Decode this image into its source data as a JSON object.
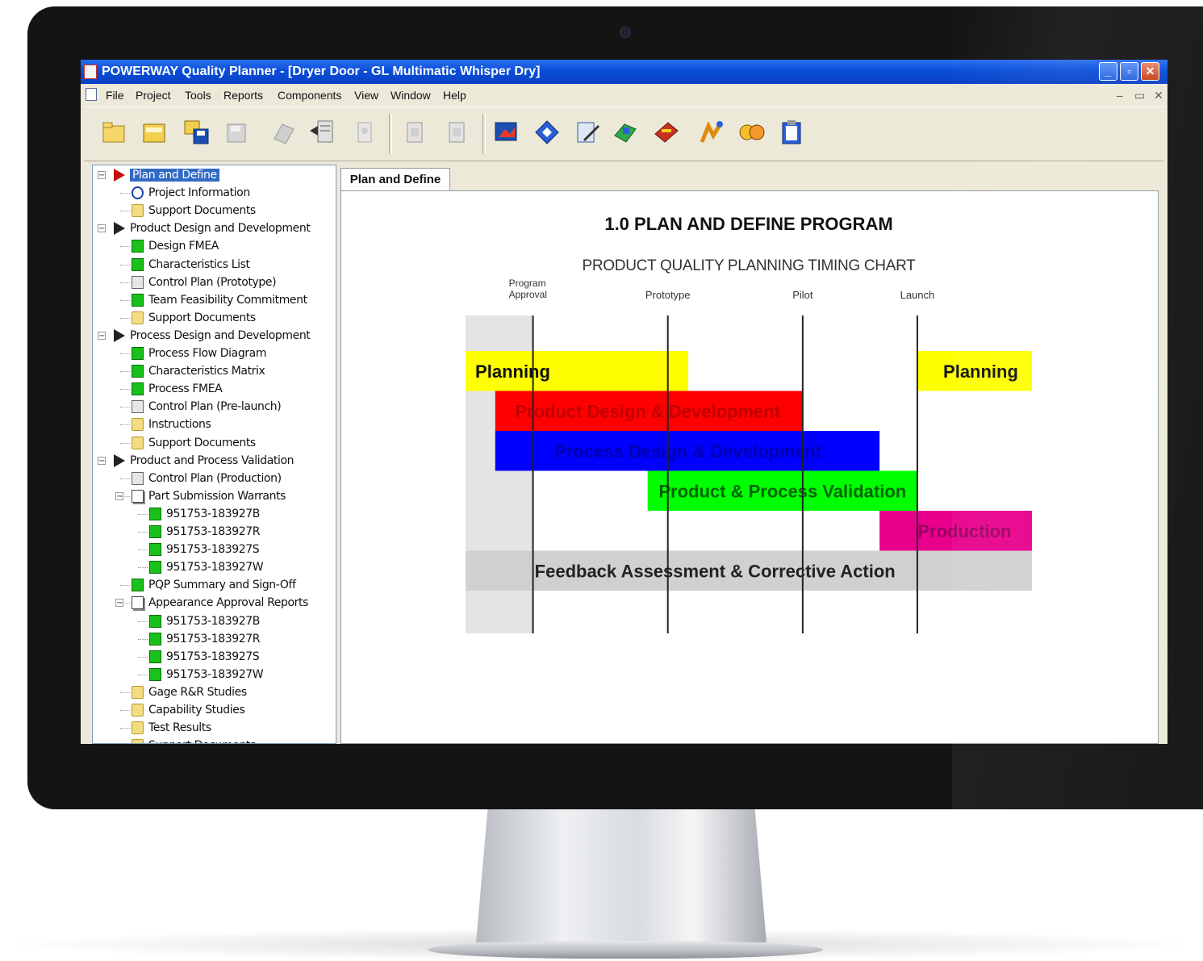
{
  "window": {
    "title": "POWERWAY Quality Planner - [Dryer Door - GL Multimatic Whisper Dry]"
  },
  "menu": [
    "File",
    "Project",
    "Tools",
    "Reports",
    "Components",
    "View",
    "Window",
    "Help"
  ],
  "toolbar_icons": [
    "new-icon",
    "open-icon",
    "copy-icon",
    "save-icon",
    "disabled-icon",
    "import-icon",
    "disabled-icon",
    "document-icon",
    "document-icon",
    "report-icon",
    "process-icon",
    "edit-icon",
    "design-icon",
    "tools-icon",
    "check-icon",
    "hands-icon",
    "clipboard-icon"
  ],
  "tree": [
    {
      "label": "Plan and Define",
      "icon": "red-arrow-icon",
      "selected": true
    },
    {
      "label": "Project Information",
      "icon": "info-icon"
    },
    {
      "label": "Support Documents",
      "icon": "folder-icon"
    },
    {
      "label": "Product Design and Development",
      "icon": "arrow-icon"
    },
    {
      "label": "Design FMEA",
      "icon": "green-doc-icon"
    },
    {
      "label": "Characteristics List",
      "icon": "green-doc-icon"
    },
    {
      "label": "Control Plan (Prototype)",
      "icon": "doc-icon"
    },
    {
      "label": "Team Feasibility Commitment",
      "icon": "green-doc-icon"
    },
    {
      "label": "Support Documents",
      "icon": "folder-icon"
    },
    {
      "label": "Process Design and Development",
      "icon": "arrow-icon"
    },
    {
      "label": "Process Flow Diagram",
      "icon": "green-doc-icon"
    },
    {
      "label": "Characteristics Matrix",
      "icon": "green-doc-icon"
    },
    {
      "label": "Process FMEA",
      "icon": "green-doc-icon"
    },
    {
      "label": "Control Plan (Pre-launch)",
      "icon": "doc-icon"
    },
    {
      "label": "Instructions",
      "icon": "folder-icon"
    },
    {
      "label": "Support Documents",
      "icon": "folder-icon"
    },
    {
      "label": "Product and Process Validation",
      "icon": "arrow-icon"
    },
    {
      "label": "Control Plan (Production)",
      "icon": "doc-icon"
    },
    {
      "label": "Part Submission Warrants",
      "icon": "multi-doc-icon"
    },
    {
      "label": "951753-183927B",
      "icon": "green-doc-icon"
    },
    {
      "label": "951753-183927R",
      "icon": "green-doc-icon"
    },
    {
      "label": "951753-183927S",
      "icon": "green-doc-icon"
    },
    {
      "label": "951753-183927W",
      "icon": "green-doc-icon"
    },
    {
      "label": "PQP Summary and Sign-Off",
      "icon": "green-doc-icon"
    },
    {
      "label": "Appearance Approval Reports",
      "icon": "multi-doc-icon"
    },
    {
      "label": "951753-183927B",
      "icon": "green-doc-icon"
    },
    {
      "label": "951753-183927R",
      "icon": "green-doc-icon"
    },
    {
      "label": "951753-183927S",
      "icon": "green-doc-icon"
    },
    {
      "label": "951753-183927W",
      "icon": "green-doc-icon"
    },
    {
      "label": "Gage R&R Studies",
      "icon": "folder-icon"
    },
    {
      "label": "Capability Studies",
      "icon": "folder-icon"
    },
    {
      "label": "Test Results",
      "icon": "folder-icon"
    },
    {
      "label": "Support Documents",
      "icon": "folder-icon"
    }
  ],
  "tab": {
    "label": "Plan and Define"
  },
  "chart_data": {
    "type": "gantt",
    "title": "1.0 PLAN AND DEFINE PROGRAM",
    "subtitle": "PRODUCT QUALITY PLANNING TIMING CHART",
    "milestones": [
      {
        "label": "Program Approval",
        "line1": "Program",
        "line2": "Approval",
        "x": 1.0
      },
      {
        "label": "Prototype",
        "x": 2.0
      },
      {
        "label": "Pilot",
        "x": 3.0
      },
      {
        "label": "Launch",
        "x": 3.85
      }
    ],
    "x_range": [
      0.5,
      4.7
    ],
    "shaded_zone": [
      0.5,
      1.0
    ],
    "bars": [
      {
        "label": "Planning",
        "start": 0.5,
        "end": 2.15,
        "color": "#ffff00",
        "text_color": "#111111",
        "label_pos": 0.85,
        "bold": true
      },
      {
        "label": "Planning",
        "start": 3.85,
        "end": 4.7,
        "color": "#ffff00",
        "text_color": "#111111",
        "label_pos": 4.32,
        "bold": true
      },
      {
        "label": "Product Design & Development",
        "start": 0.72,
        "end": 3.0,
        "color": "#ff0000",
        "text_color": "#c00000",
        "label_pos": 1.85,
        "bold": true
      },
      {
        "label": "Process Design & Development",
        "start": 0.72,
        "end": 3.57,
        "color": "#0000ff",
        "text_color": "#0000b0",
        "label_pos": 2.15,
        "bold": true
      },
      {
        "label": "Product & Process Validation",
        "start": 1.85,
        "end": 3.85,
        "color": "#00ff00",
        "text_color": "#006600",
        "label_pos": 2.85,
        "bold": true
      },
      {
        "label": "Production",
        "start": 3.57,
        "end": 4.7,
        "color": "#e8008c",
        "text_color": "#9a0060",
        "label_pos": 4.2,
        "bold": true
      },
      {
        "label": "Feedback Assessment & Corrective Action",
        "start": 0.5,
        "end": 4.7,
        "color": "#d0d0d0",
        "text_color": "#222222",
        "label_pos": 2.35,
        "bold": true
      }
    ],
    "colors": {
      "shade": "#e4e4e4",
      "lines": "#222222"
    }
  }
}
